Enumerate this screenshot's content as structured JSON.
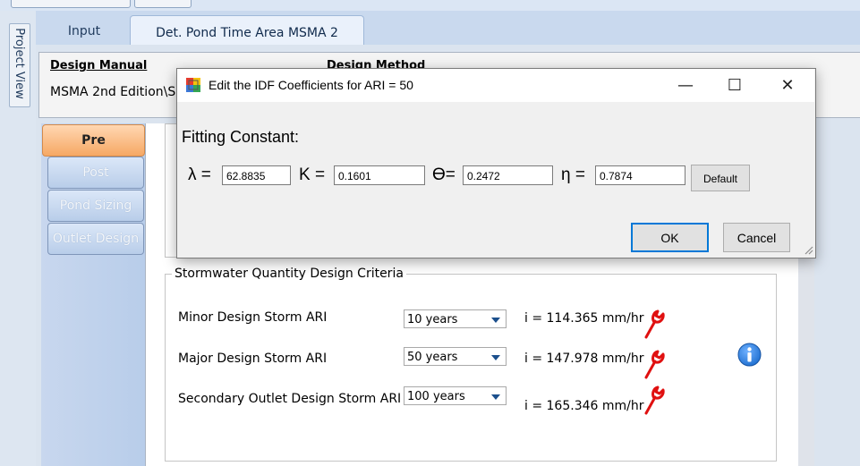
{
  "window": {
    "project_view_label": "Project View"
  },
  "tabs": [
    {
      "label": "Input"
    },
    {
      "label": "Det. Pond Time Area MSMA 2"
    }
  ],
  "design": {
    "manual_label": "Design Manual",
    "manual_value": "MSMA 2nd Edition\\S",
    "method_label": "Design Method"
  },
  "nav": [
    {
      "label": "Pre"
    },
    {
      "label": "Post"
    },
    {
      "label": "Pond Sizing"
    },
    {
      "label": "Outlet Design"
    }
  ],
  "criteria": {
    "title": "Stormwater Quantity Design Criteria",
    "rows": [
      {
        "label": "Minor Design Storm ARI",
        "selected": "10 years",
        "intensity": "i = 114.365 mm/hr"
      },
      {
        "label": "Major Design Storm ARI",
        "selected": "50 years",
        "intensity": "i = 147.978 mm/hr"
      },
      {
        "label": "Secondary Outlet Design Storm ARI",
        "selected": "100 years",
        "intensity": "i = 165.346 mm/hr"
      }
    ]
  },
  "dialog": {
    "title": "Edit the IDF Coefficients for ARI = 50",
    "heading": "Fitting Constant:",
    "fields": [
      {
        "symbol": "λ =",
        "value": "62.8835"
      },
      {
        "symbol": "K =",
        "value": "0.1601"
      },
      {
        "symbol": "ϴ=",
        "value": "0.2472"
      },
      {
        "symbol": "η =",
        "value": "0.7874"
      }
    ],
    "default_label": "Default",
    "ok_label": "OK",
    "cancel_label": "Cancel",
    "minimize_glyph": "—",
    "maximize_glyph": "☐",
    "close_glyph": "✕"
  },
  "colors": {
    "nav_active": "#f6a864",
    "wrench": "#e01010",
    "info": "#1e6fd0"
  }
}
